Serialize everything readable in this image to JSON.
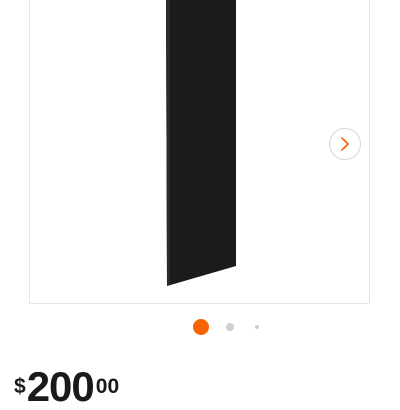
{
  "product_gallery": {
    "image_icon": "black-filler-panel",
    "next_arrow_icon": "chevron-right-icon",
    "dots": [
      {
        "active": true
      },
      {
        "active": false
      },
      {
        "active": false
      }
    ],
    "colors": {
      "dot_active": "#f96302",
      "dot_inactive": "#cfcfcf",
      "arrow": "#f96302",
      "panel": "#1b1b1b"
    }
  },
  "price": {
    "currency_symbol": "$",
    "dollars": "200",
    "cents": "00"
  }
}
